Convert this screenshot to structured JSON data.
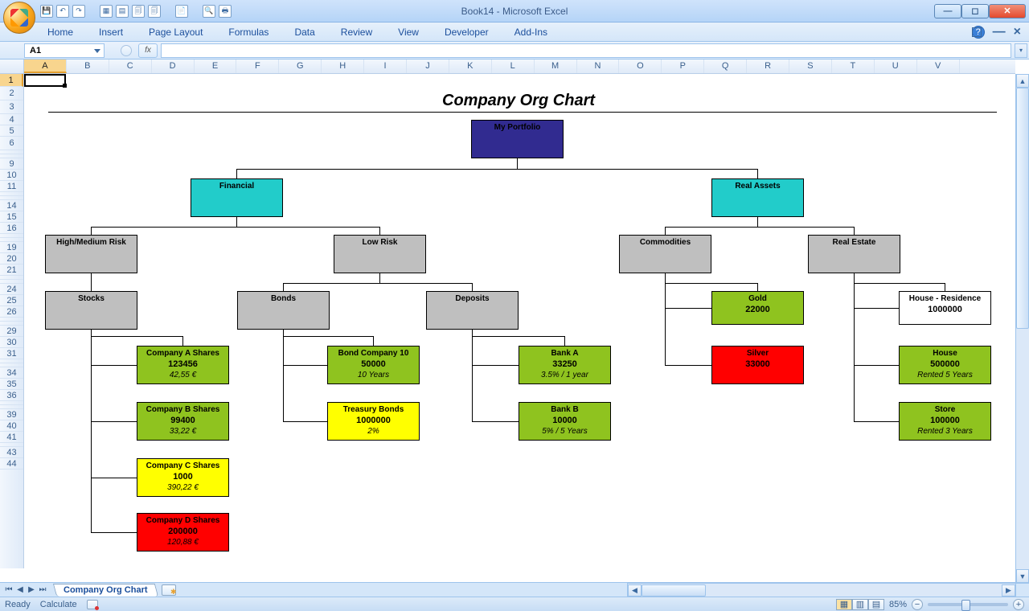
{
  "app": {
    "title": "Book14 - Microsoft Excel"
  },
  "ribbon_tabs": [
    "Home",
    "Insert",
    "Page Layout",
    "Formulas",
    "Data",
    "Review",
    "View",
    "Developer",
    "Add-Ins"
  ],
  "namebox": "A1",
  "fx_label": "fx",
  "columns": [
    "A",
    "B",
    "C",
    "D",
    "E",
    "F",
    "G",
    "H",
    "I",
    "J",
    "K",
    "L",
    "M",
    "N",
    "O",
    "P",
    "Q",
    "R",
    "S",
    "T",
    "U",
    "V"
  ],
  "sheet_tab": "Company Org Chart",
  "status": {
    "ready": "Ready",
    "calculate": "Calculate",
    "zoom": "85%"
  },
  "chart_title": "Company Org Chart",
  "nodes": {
    "root": "My Portfolio",
    "financial": "Financial",
    "real_assets": "Real Assets",
    "hmrisk": "High/Medium Risk",
    "lowrisk": "Low Risk",
    "commodities": "Commodities",
    "realestate": "Real Estate",
    "stocks": "Stocks",
    "bonds": "Bonds",
    "deposits": "Deposits",
    "gold": {
      "name": "Gold",
      "v": "22000"
    },
    "silver": {
      "name": "Silver",
      "v": "33000"
    },
    "house_res": {
      "name": "House - Residence",
      "v": "1000000"
    },
    "house": {
      "name": "House",
      "v": "500000",
      "v2": "Rented 5 Years"
    },
    "store": {
      "name": "Store",
      "v": "100000",
      "v2": "Rented 3 Years"
    },
    "compA": {
      "name": "Company A Shares",
      "v": "123456",
      "v2": "42,55 €"
    },
    "compB": {
      "name": "Company B Shares",
      "v": "99400",
      "v2": "33,22 €"
    },
    "compC": {
      "name": "Company C Shares",
      "v": "1000",
      "v2": "390,22 €"
    },
    "compD": {
      "name": "Company D Shares",
      "v": "200000",
      "v2": "120,88 €"
    },
    "bond10": {
      "name": "Bond Company 10",
      "v": "50000",
      "v2": "10 Years"
    },
    "tbonds": {
      "name": "Treasury Bonds",
      "v": "1000000",
      "v2": "2%"
    },
    "bankA": {
      "name": "Bank A",
      "v": "33250",
      "v2": "3.5% / 1 year"
    },
    "bankB": {
      "name": "Bank B",
      "v": "10000",
      "v2": "5% / 5 Years"
    }
  },
  "chart_data": {
    "type": "tree",
    "title": "Company Org Chart",
    "root": {
      "name": "My Portfolio",
      "children": [
        {
          "name": "Financial",
          "children": [
            {
              "name": "High/Medium Risk",
              "children": [
                {
                  "name": "Stocks",
                  "children": [
                    {
                      "name": "Company A Shares",
                      "value": 123456,
                      "price": "42,55 €",
                      "color": "green"
                    },
                    {
                      "name": "Company B Shares",
                      "value": 99400,
                      "price": "33,22 €",
                      "color": "green"
                    },
                    {
                      "name": "Company C Shares",
                      "value": 1000,
                      "price": "390,22 €",
                      "color": "yellow"
                    },
                    {
                      "name": "Company D Shares",
                      "value": 200000,
                      "price": "120,88 €",
                      "color": "red"
                    }
                  ]
                }
              ]
            },
            {
              "name": "Low Risk",
              "children": [
                {
                  "name": "Bonds",
                  "children": [
                    {
                      "name": "Bond Company 10",
                      "value": 50000,
                      "note": "10 Years",
                      "color": "green"
                    },
                    {
                      "name": "Treasury Bonds",
                      "value": 1000000,
                      "note": "2%",
                      "color": "yellow"
                    }
                  ]
                },
                {
                  "name": "Deposits",
                  "children": [
                    {
                      "name": "Bank A",
                      "value": 33250,
                      "note": "3.5% / 1 year",
                      "color": "green"
                    },
                    {
                      "name": "Bank B",
                      "value": 10000,
                      "note": "5% / 5 Years",
                      "color": "green"
                    }
                  ]
                }
              ]
            }
          ]
        },
        {
          "name": "Real Assets",
          "children": [
            {
              "name": "Commodities",
              "children": [
                {
                  "name": "Gold",
                  "value": 22000,
                  "color": "green"
                },
                {
                  "name": "Silver",
                  "value": 33000,
                  "color": "red"
                }
              ]
            },
            {
              "name": "Real Estate",
              "children": [
                {
                  "name": "House - Residence",
                  "value": 1000000,
                  "color": "white"
                },
                {
                  "name": "House",
                  "value": 500000,
                  "note": "Rented 5 Years",
                  "color": "green"
                },
                {
                  "name": "Store",
                  "value": 100000,
                  "note": "Rented 3 Years",
                  "color": "green"
                }
              ]
            }
          ]
        }
      ]
    }
  }
}
